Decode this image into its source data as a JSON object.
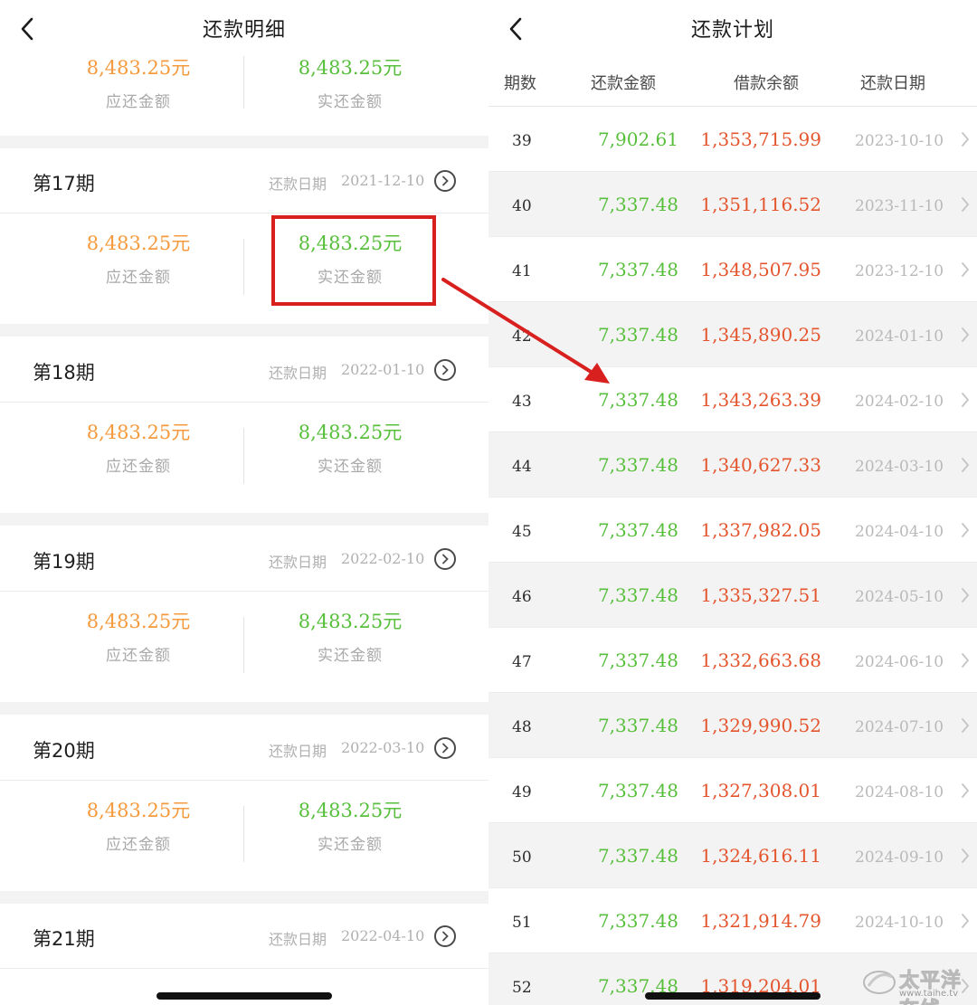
{
  "left": {
    "title": "还款明细",
    "top_partial": {
      "due_amount": "8,483.25元",
      "due_label": "应还金额",
      "paid_amount": "8,483.25元",
      "paid_label": "实还金额"
    },
    "periods": [
      {
        "name": "第17期",
        "date_label": "还款日期",
        "date": "2021-12-10",
        "due_amount": "8,483.25元",
        "due_label": "应还金额",
        "paid_amount": "8,483.25元",
        "paid_label": "实还金额"
      },
      {
        "name": "第18期",
        "date_label": "还款日期",
        "date": "2022-01-10",
        "due_amount": "8,483.25元",
        "due_label": "应还金额",
        "paid_amount": "8,483.25元",
        "paid_label": "实还金额"
      },
      {
        "name": "第19期",
        "date_label": "还款日期",
        "date": "2022-02-10",
        "due_amount": "8,483.25元",
        "due_label": "应还金额",
        "paid_amount": "8,483.25元",
        "paid_label": "实还金额"
      },
      {
        "name": "第20期",
        "date_label": "还款日期",
        "date": "2022-03-10",
        "due_amount": "8,483.25元",
        "due_label": "应还金额",
        "paid_amount": "8,483.25元",
        "paid_label": "实还金额"
      },
      {
        "name": "第21期",
        "date_label": "还款日期",
        "date": "2022-04-10"
      }
    ]
  },
  "right": {
    "title": "还款计划",
    "headers": [
      "期数",
      "还款金额",
      "借款余额",
      "还款日期"
    ],
    "rows": [
      {
        "period": "39",
        "amount": "7,902.61",
        "balance": "1,353,715.99",
        "date": "2023-10-10"
      },
      {
        "period": "40",
        "amount": "7,337.48",
        "balance": "1,351,116.52",
        "date": "2023-11-10"
      },
      {
        "period": "41",
        "amount": "7,337.48",
        "balance": "1,348,507.95",
        "date": "2023-12-10"
      },
      {
        "period": "42",
        "amount": "7,337.48",
        "balance": "1,345,890.25",
        "date": "2024-01-10"
      },
      {
        "period": "43",
        "amount": "7,337.48",
        "balance": "1,343,263.39",
        "date": "2024-02-10"
      },
      {
        "period": "44",
        "amount": "7,337.48",
        "balance": "1,340,627.33",
        "date": "2024-03-10"
      },
      {
        "period": "45",
        "amount": "7,337.48",
        "balance": "1,337,982.05",
        "date": "2024-04-10"
      },
      {
        "period": "46",
        "amount": "7,337.48",
        "balance": "1,335,327.51",
        "date": "2024-05-10"
      },
      {
        "period": "47",
        "amount": "7,337.48",
        "balance": "1,332,663.68",
        "date": "2024-06-10"
      },
      {
        "period": "48",
        "amount": "7,337.48",
        "balance": "1,329,990.52",
        "date": "2024-07-10"
      },
      {
        "period": "49",
        "amount": "7,337.48",
        "balance": "1,327,308.01",
        "date": "2024-08-10"
      },
      {
        "period": "50",
        "amount": "7,337.48",
        "balance": "1,324,616.11",
        "date": "2024-09-10"
      },
      {
        "period": "51",
        "amount": "7,337.48",
        "balance": "1,321,914.79",
        "date": "2024-10-10"
      },
      {
        "period": "52",
        "amount": "7,337.48",
        "balance": "1,319,204.01",
        "date": ""
      }
    ]
  },
  "watermark": {
    "text": "太平洋在线",
    "url": "www.taihe.tv"
  },
  "colors": {
    "due": "#f59a3c",
    "paid": "#57bf3b",
    "balance": "#e4552e",
    "highlight": "#d8201f"
  }
}
